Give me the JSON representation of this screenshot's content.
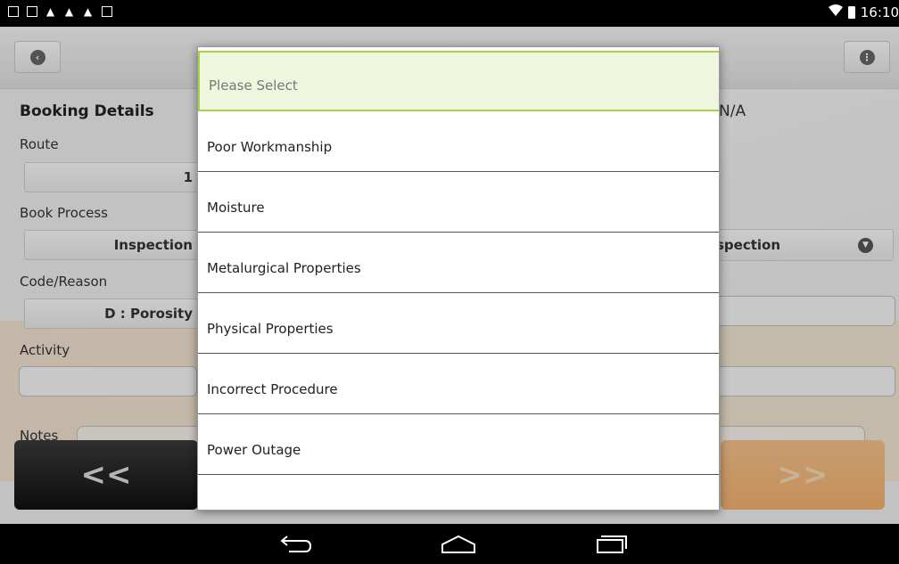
{
  "status_bar": {
    "time": "16:10",
    "left_icons": [
      "download-icon",
      "image-icon",
      "warning-icon",
      "warning-icon",
      "warning-icon",
      "shopping-bag-icon"
    ],
    "right_icons": [
      "wifi-icon",
      "battery-icon"
    ]
  },
  "header": {
    "back_icon": "circle-back-icon",
    "menu_icon": "circle-menu-icon"
  },
  "form": {
    "section_title": "Booking Details",
    "na_value": "N/A",
    "route_label": "Route",
    "route_value": "1",
    "book_process_label": "Book Process",
    "book_process_value": "Inspection",
    "right_select_value": "spection",
    "code_reason_label": "Code/Reason",
    "code_reason_value": "D : Porosity",
    "activity_label": "Activity",
    "notes_label": "Notes"
  },
  "nav_buttons": {
    "prev_label": "<<",
    "next_label": ">>"
  },
  "dropdown": {
    "options": [
      {
        "label": "Please Select",
        "selected": true
      },
      {
        "label": "Poor Workmanship",
        "selected": false
      },
      {
        "label": "Moisture",
        "selected": false
      },
      {
        "label": "Metalurgical Properties",
        "selected": false
      },
      {
        "label": "Physical Properties",
        "selected": false
      },
      {
        "label": "Incorrect Procedure",
        "selected": false
      },
      {
        "label": "Power Outage",
        "selected": false
      }
    ]
  },
  "system_nav": {
    "back_icon": "back-arrow-icon",
    "home_icon": "home-icon",
    "recents_icon": "recent-apps-icon"
  },
  "colors": {
    "selected_border": "#a8d14a",
    "selected_bg": "#eef7dd",
    "next_button": "#f1b06e"
  }
}
